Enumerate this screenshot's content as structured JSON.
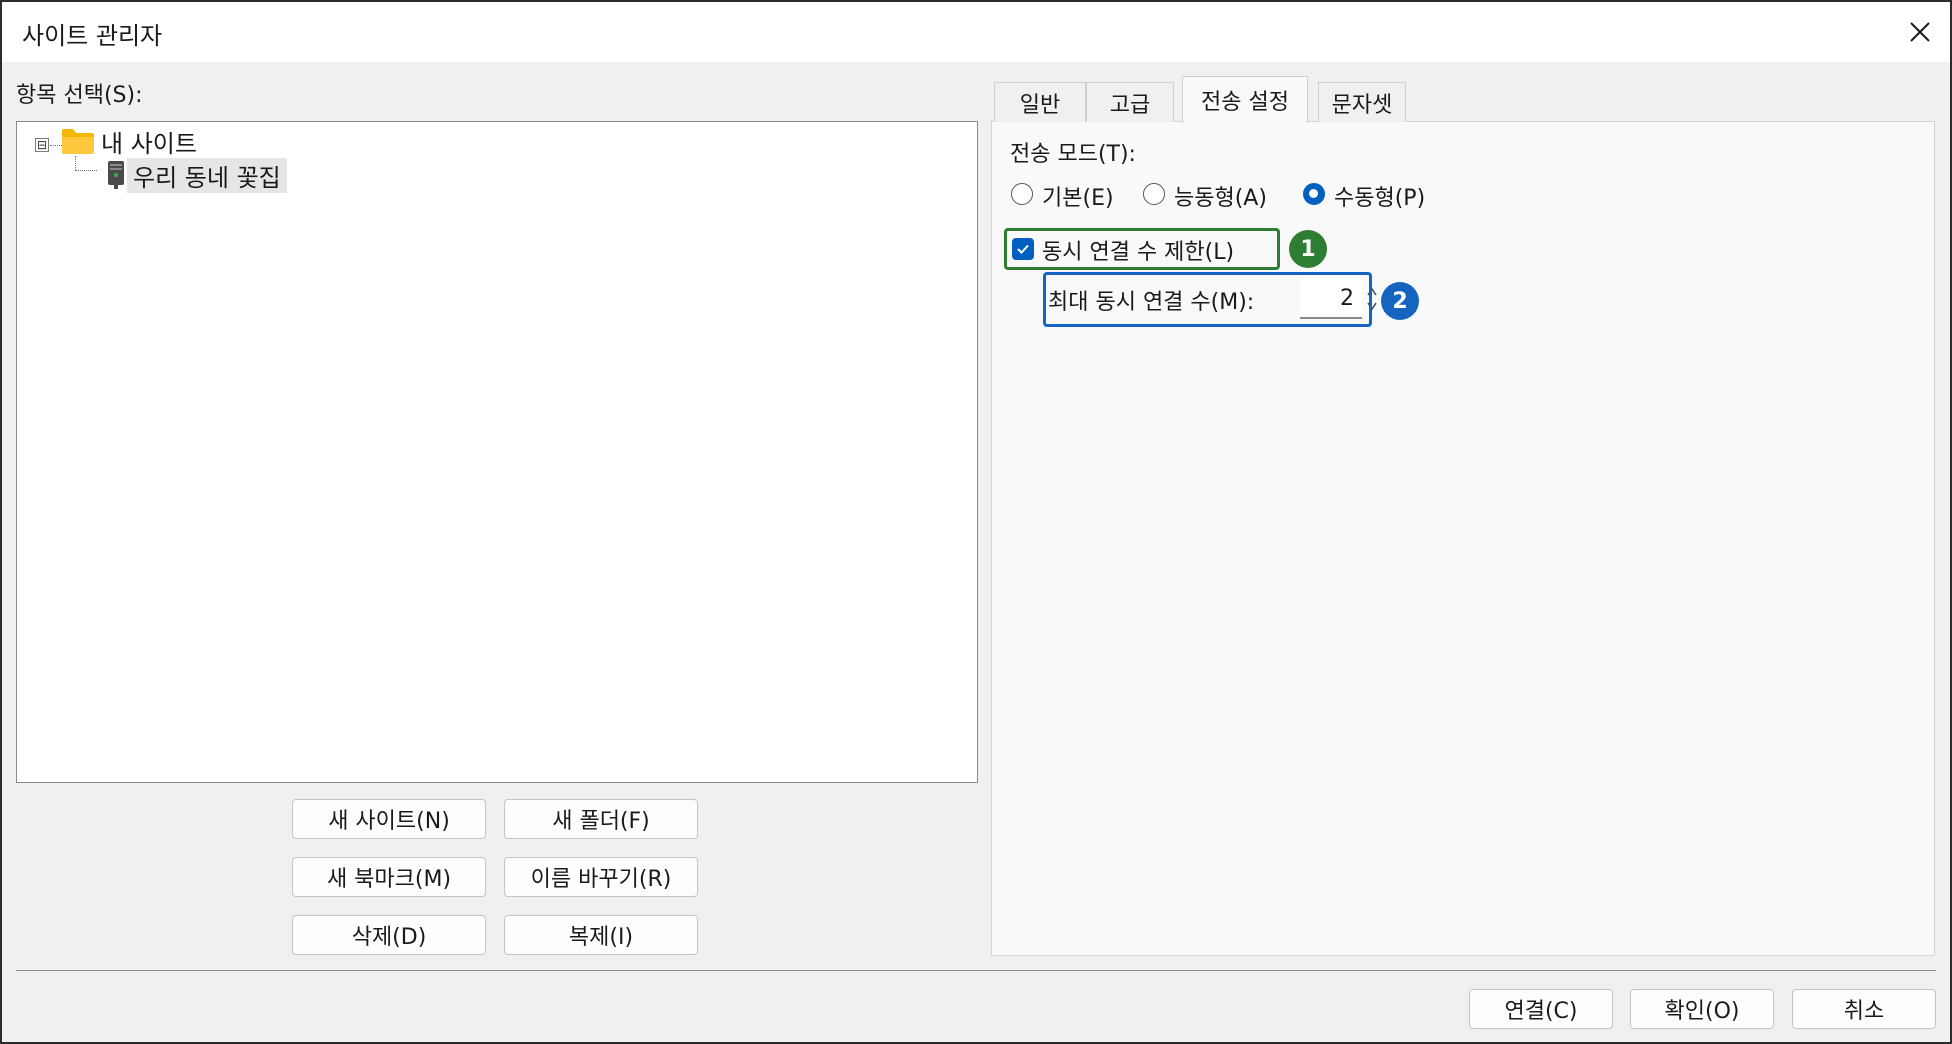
{
  "window": {
    "title": "사이트 관리자"
  },
  "left": {
    "select_label": "항목 선택(S):",
    "tree": {
      "root_label": "내 사이트",
      "child_label": "우리 동네 꽃집",
      "expander": "⊟"
    },
    "buttons": {
      "new_site": "새 사이트(N)",
      "new_folder": "새 폴더(F)",
      "new_bookmark": "새 북마크(M)",
      "rename": "이름 바꾸기(R)",
      "delete": "삭제(D)",
      "duplicate": "복제(I)"
    }
  },
  "tabs": [
    {
      "label": "일반"
    },
    {
      "label": "고급"
    },
    {
      "label": "전송 설정",
      "active": true
    },
    {
      "label": "문자셋"
    }
  ],
  "transfer": {
    "mode_label": "전송 모드(T):",
    "modes": [
      {
        "label": "기본(E)",
        "selected": false
      },
      {
        "label": "능동형(A)",
        "selected": false
      },
      {
        "label": "수동형(P)",
        "selected": true
      }
    ],
    "limit_checkbox_label": "동시 연결 수 제한(L)",
    "limit_checked": true,
    "max_label": "최대 동시 연결 수(M):",
    "max_value": "2"
  },
  "annotations": {
    "badge1": "1",
    "badge2": "2",
    "green": "#2e7d32",
    "blue": "#1565c0"
  },
  "footer": {
    "connect": "연결(C)",
    "ok": "확인(O)",
    "cancel": "취소"
  }
}
